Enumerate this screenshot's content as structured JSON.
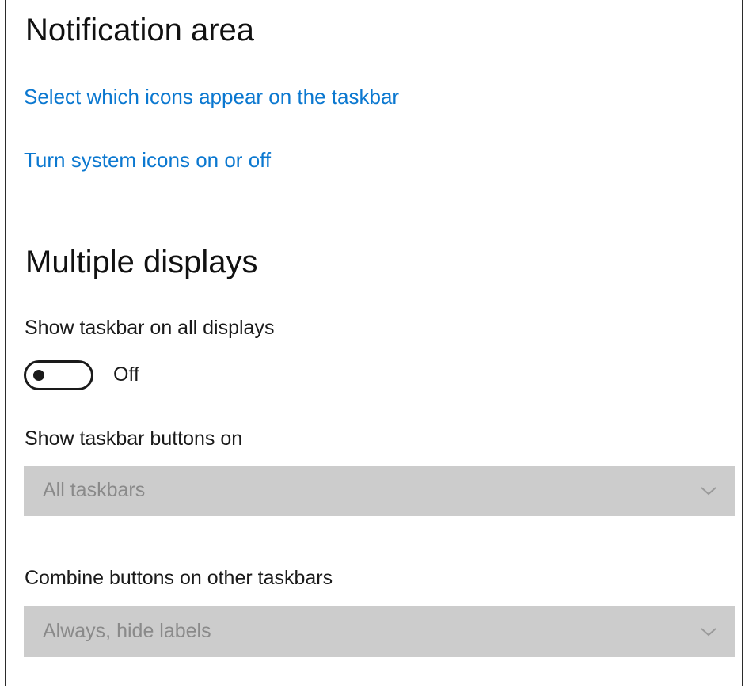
{
  "notification_area": {
    "title": "Notification area",
    "link_select_icons": "Select which icons appear on the taskbar",
    "link_system_icons": "Turn system icons on or off"
  },
  "multiple_displays": {
    "title": "Multiple displays",
    "show_taskbar_label": "Show taskbar on all displays",
    "show_taskbar_toggle": {
      "state_text": "Off",
      "is_on": false
    },
    "buttons_on": {
      "label": "Show taskbar buttons on",
      "selected": "All taskbars",
      "disabled": true
    },
    "combine_buttons": {
      "label": "Combine buttons on other taskbars",
      "selected": "Always, hide labels",
      "disabled": true
    }
  },
  "colors": {
    "link": "#0b78d0",
    "dropdown_disabled_bg": "#cccccc",
    "dropdown_disabled_text": "#8a8a8a"
  },
  "icons": {
    "dropdown_chevron": "chevron-down-icon"
  }
}
